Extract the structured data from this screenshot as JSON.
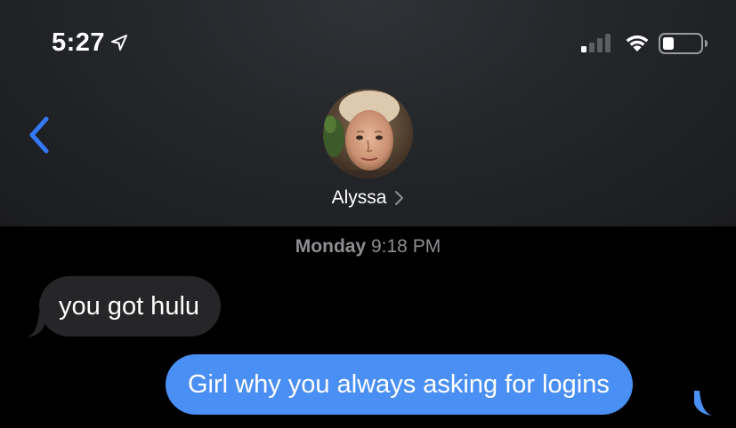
{
  "status_bar": {
    "time": "5:27",
    "icons": [
      "location-arrow-icon",
      "cellular-signal-icon",
      "wifi-icon",
      "battery-icon"
    ]
  },
  "header": {
    "back_icon": "chevron-left-icon",
    "contact_name": "Alyssa",
    "contact_chevron_icon": "chevron-right-icon"
  },
  "conversation": {
    "timestamp_day": "Monday",
    "timestamp_time": "9:18 PM",
    "messages": [
      {
        "direction": "received",
        "text": "you got hulu"
      },
      {
        "direction": "sent",
        "text": "Girl why you always asking for logins"
      }
    ]
  },
  "colors": {
    "background": "#000000",
    "header_background": "#232529",
    "accent_blue": "#3478f6",
    "sent_bubble": "#4a8ff4",
    "received_bubble": "#262628",
    "timestamp_gray": "#8e8e93"
  }
}
